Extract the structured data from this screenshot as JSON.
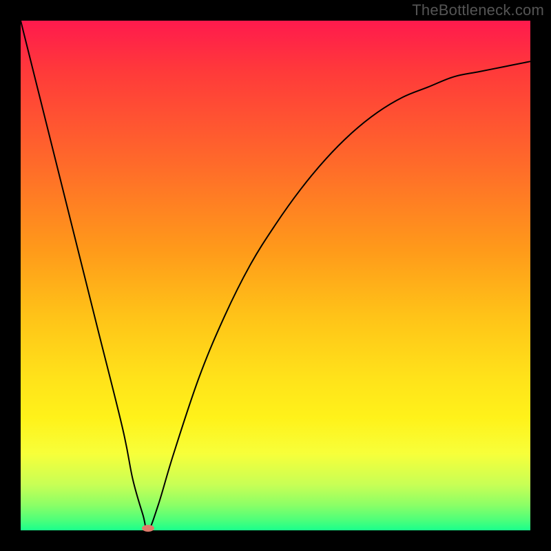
{
  "watermark": "TheBottleneck.com",
  "colors": {
    "frame_bg": "#000000",
    "gradient_top": "#ff1a4d",
    "gradient_bottom": "#1aff8c",
    "curve": "#000000",
    "marker": "#e07a6a"
  },
  "chart_data": {
    "type": "line",
    "title": "",
    "xlabel": "",
    "ylabel": "",
    "xlim": [
      0,
      100
    ],
    "ylim": [
      0,
      100
    ],
    "grid": false,
    "legend": false,
    "notes": "V-shaped bottleneck curve over vertical red→green gradient; minimum marked by small pink ellipse near bottom.",
    "series": [
      {
        "name": "bottleneck-curve",
        "x": [
          0,
          5,
          10,
          15,
          20,
          22,
          24,
          25,
          27,
          30,
          35,
          40,
          45,
          50,
          55,
          60,
          65,
          70,
          75,
          80,
          85,
          90,
          95,
          100
        ],
        "y": [
          100,
          80,
          60,
          40,
          20,
          10,
          3,
          0,
          5,
          15,
          30,
          42,
          52,
          60,
          67,
          73,
          78,
          82,
          85,
          87,
          89,
          90,
          91,
          92
        ]
      }
    ],
    "marker": {
      "x": 25,
      "y": 0
    }
  }
}
